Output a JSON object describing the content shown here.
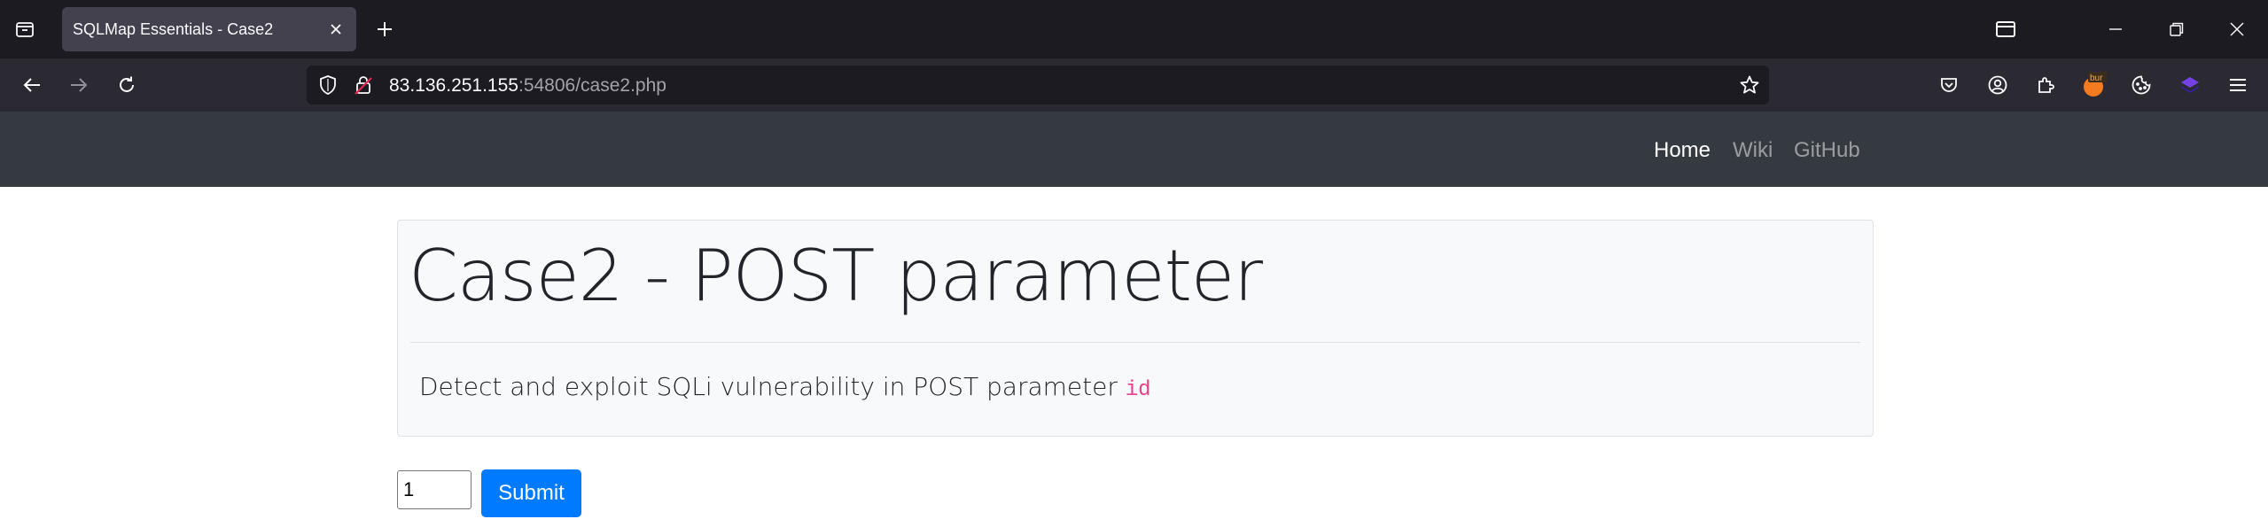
{
  "browser": {
    "tab": {
      "title": "SQLMap Essentials - Case2"
    },
    "url": {
      "host": "83.136.251.155",
      "rest": ":54806/case2.php"
    },
    "colors": {
      "chrome_dark": "#1c1b22",
      "toolbar": "#2b2a33",
      "tab_active": "#42414d"
    },
    "icons": [
      "tab-list-icon",
      "close-icon",
      "plus-icon",
      "back-icon",
      "forward-icon",
      "reload-icon",
      "shield-icon",
      "insecure-lock-icon",
      "star-icon",
      "pocket-icon",
      "account-icon",
      "extensions-icon",
      "burp-extension-icon",
      "cookie-icon",
      "layers-extension-icon",
      "menu-icon",
      "tab-overview-icon",
      "minimize-icon",
      "restore-icon",
      "window-close-icon"
    ],
    "burp_badge": "bur"
  },
  "site_nav": {
    "links": [
      {
        "label": "Home",
        "active": true
      },
      {
        "label": "Wiki",
        "active": false
      },
      {
        "label": "GitHub",
        "active": false
      }
    ],
    "colors": {
      "background": "#343a40"
    }
  },
  "jumbotron": {
    "title": "Case2 - POST parameter",
    "lead": "Detect and exploit SQLi vulnerability in POST parameter ",
    "param": "id",
    "colors": {
      "background": "#f8f9fa",
      "code": "#e83e8c"
    }
  },
  "form": {
    "id_value": "1",
    "submit_label": "Submit",
    "colors": {
      "button": "#007bff"
    }
  }
}
